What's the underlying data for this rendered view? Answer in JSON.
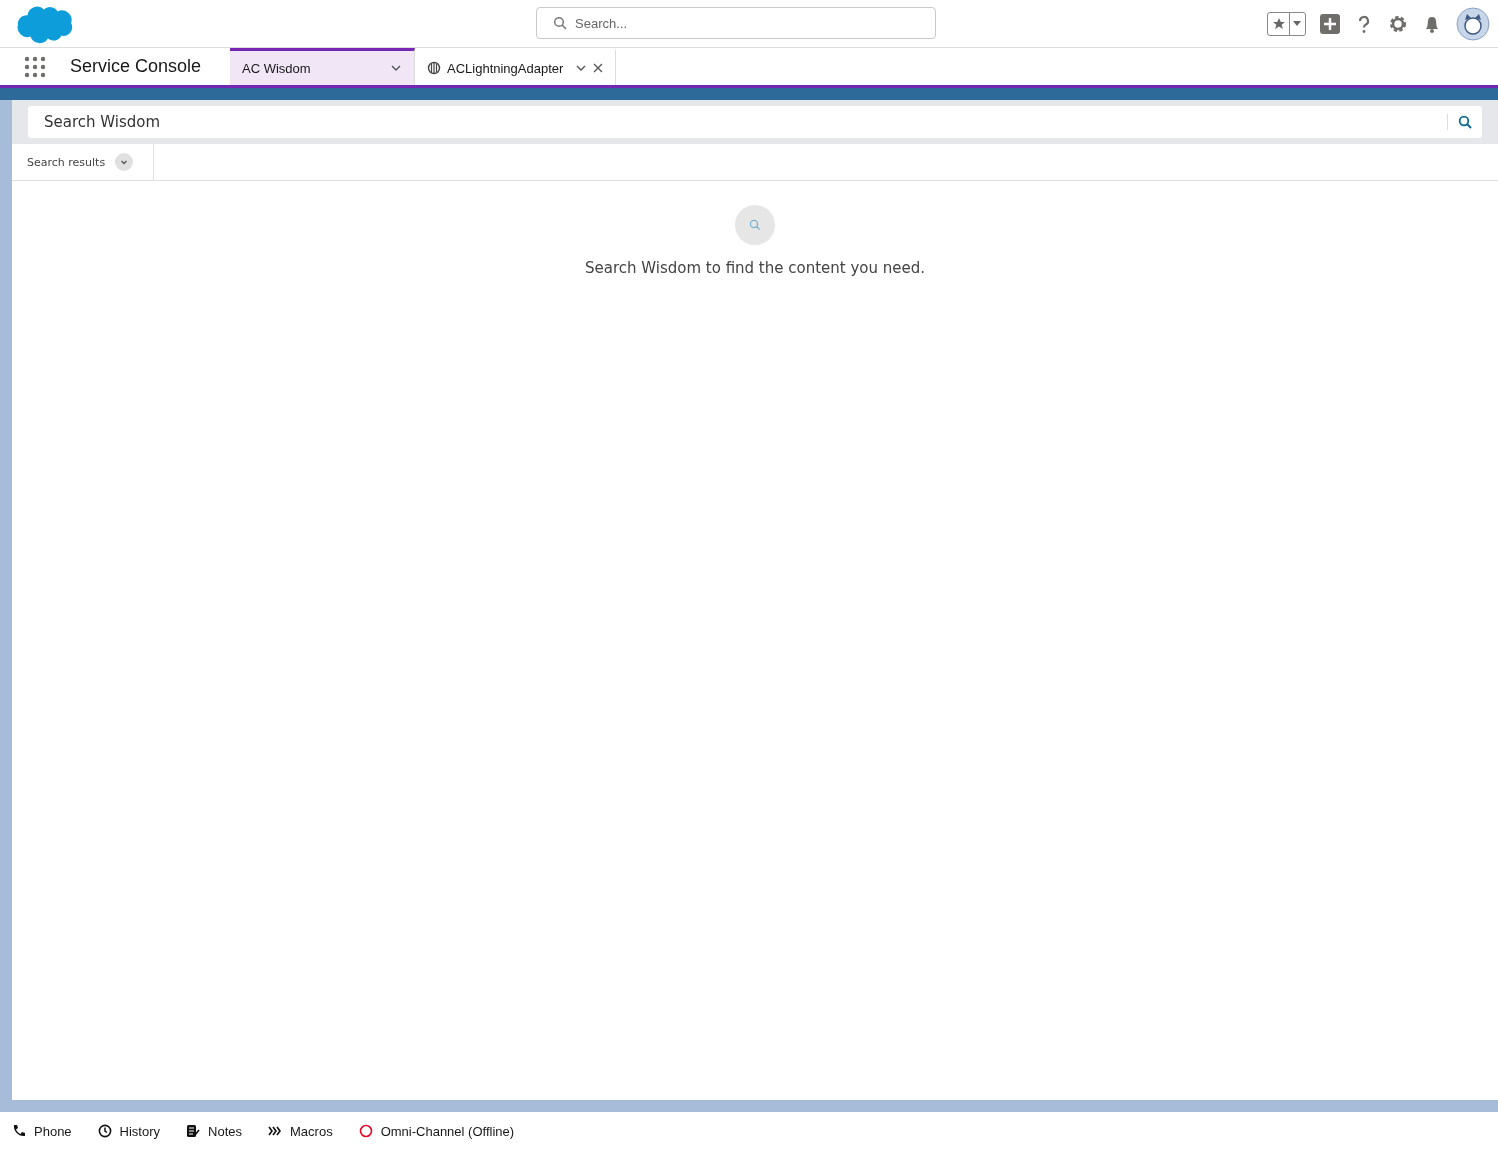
{
  "header": {
    "search": {
      "placeholder": "Search..."
    }
  },
  "nav": {
    "app_name": "Service Console",
    "tabs": [
      {
        "label": "AC Wisdom",
        "kind": "object",
        "selected": true,
        "closable": false
      },
      {
        "label": "ACLightningAdapter",
        "kind": "globe",
        "selected": false,
        "closable": true
      }
    ]
  },
  "wisdom": {
    "search": {
      "placeholder": "Search Wisdom"
    },
    "filter": "Search results",
    "empty_message": "Search Wisdom to find the content you need."
  },
  "utility_bar": [
    {
      "label": "Phone",
      "kind": "phone"
    },
    {
      "label": "History",
      "kind": "clock"
    },
    {
      "label": "Notes",
      "kind": "notes"
    },
    {
      "label": "Macros",
      "kind": "macros"
    },
    {
      "label": "Omni-Channel (Offline)",
      "kind": "status"
    }
  ]
}
